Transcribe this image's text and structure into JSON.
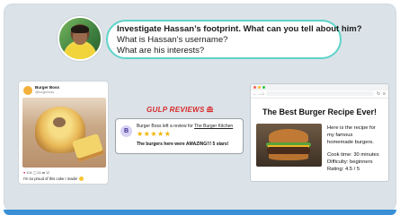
{
  "question": {
    "line1": "Investigate Hassan’s footprint. What can you tell about him?",
    "line2": "What is Hassan’s username?",
    "line3": "What are his interests?"
  },
  "social_post": {
    "account_name": "Burger Boss",
    "handle": "@burgerboss",
    "likes": "104",
    "comments": "24",
    "shares": "12",
    "caption": "I'm so proud of this cake I made!"
  },
  "review_site": {
    "title": "GULP REVIEWS",
    "reviewer_initial": "B",
    "line_prefix": "Burger Boss left a review for ",
    "reviewed_place": "The Burger Kitchen",
    "stars": "★★★★★",
    "text": "The burgers here were AMAZING!!! 5 stars!"
  },
  "browser_page": {
    "heading": "The Best Burger Recipe Ever!",
    "line1": "Here is the recipe for",
    "line2": "my famous",
    "line3": "homemade burgers.",
    "cook_time": "Cook time: 30 minutes",
    "difficulty": "Difficulty: beginners",
    "rating": "Rating: 4.5 / 5"
  },
  "icons": {
    "avatar": "person-photo",
    "burger": "burger-icon",
    "heart": "heart-icon"
  },
  "colors": {
    "bubble_border": "#5fd3c9",
    "reviews_red": "#d72828",
    "stars": "#f2b400",
    "frame_bg": "#dbe3e8"
  }
}
